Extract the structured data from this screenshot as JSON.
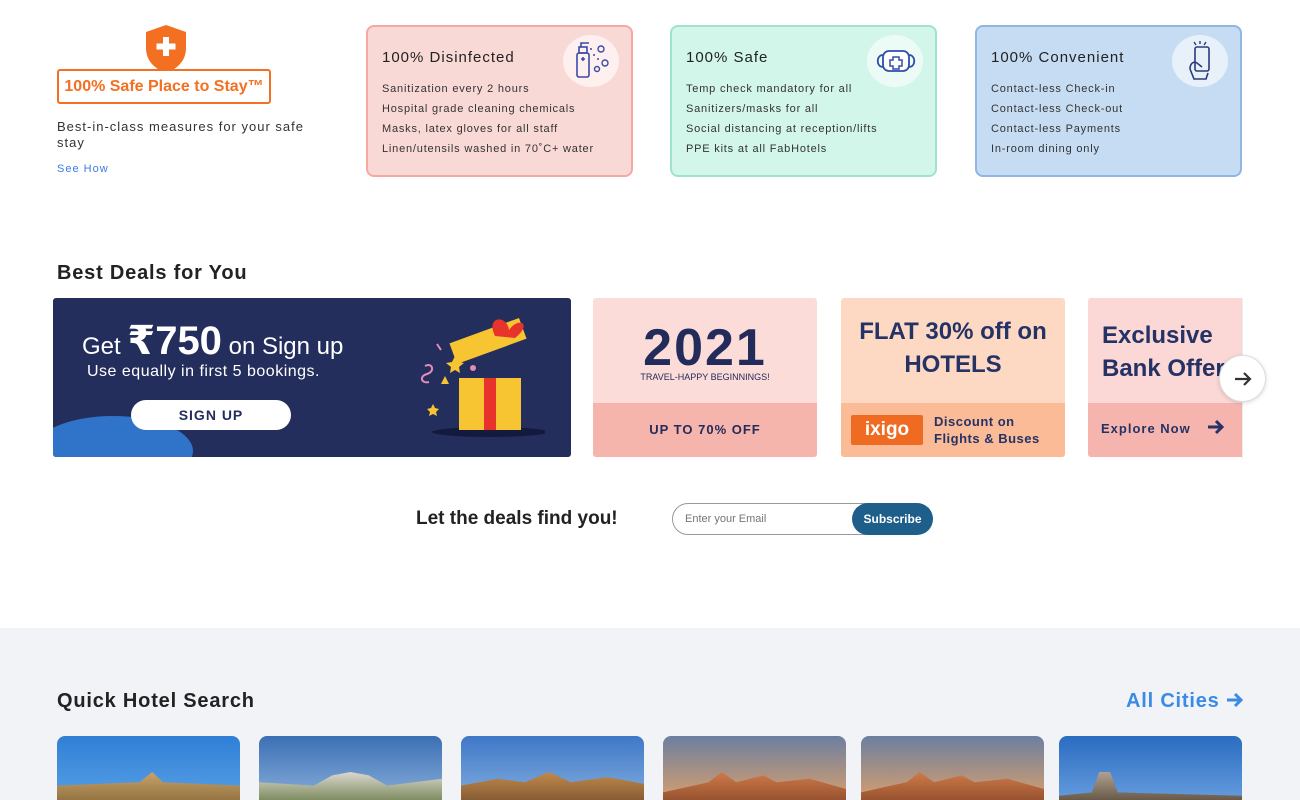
{
  "safety": {
    "badge_label": "100% Safe Place to Stay™",
    "description": "Best-in-class measures for your safe stay",
    "see_how": "See How",
    "cards": [
      {
        "title": "100% Disinfected",
        "icon": "sanitizer-icon",
        "items": [
          "Sanitization every 2 hours",
          "Hospital grade cleaning chemicals",
          "Masks, latex gloves for all staff",
          "Linen/utensils washed in 70˚C+ water"
        ]
      },
      {
        "title": "100% Safe",
        "icon": "mask-icon",
        "items": [
          "Temp check mandatory for all",
          "Sanitizers/masks for all",
          "Social distancing at reception/lifts",
          "PPE kits at all FabHotels"
        ]
      },
      {
        "title": "100% Convenient",
        "icon": "contactless-phone-icon",
        "items": [
          "Contact-less Check-in",
          "Contact-less Check-out",
          "Contact-less Payments",
          "In-room dining only"
        ]
      }
    ]
  },
  "deals": {
    "title": "Best Deals for You",
    "signup": {
      "get": "Get ",
      "amount": "₹750",
      "rest": " on Sign up",
      "sub": "Use equally in first 5 bookings.",
      "button": "SIGN UP"
    },
    "year_offer": {
      "year": "2021",
      "tagline": "TRAVEL-HAPPY BEGINNINGS!",
      "bottom": "UP TO 70% OFF"
    },
    "flat_offer": {
      "headline_1": "FLAT 30% off on",
      "headline_2": "HOTELS",
      "partner": "ixigo",
      "note_1": "Discount on",
      "note_2": "Flights & Buses"
    },
    "bank_offer": {
      "headline_1": "Exclusive",
      "headline_2": "Bank Offer",
      "cta": "Explore Now"
    }
  },
  "subscribe": {
    "label": "Let the deals find you!",
    "placeholder": "Enter your Email",
    "button": "Subscribe"
  },
  "quick_search": {
    "title": "Quick Hotel Search",
    "all_cities": "All Cities"
  },
  "colors": {
    "orange": "#f36f21",
    "navy": "#242e5c",
    "link_blue": "#3a8be6",
    "subscribe_blue": "#1d5f8a"
  }
}
